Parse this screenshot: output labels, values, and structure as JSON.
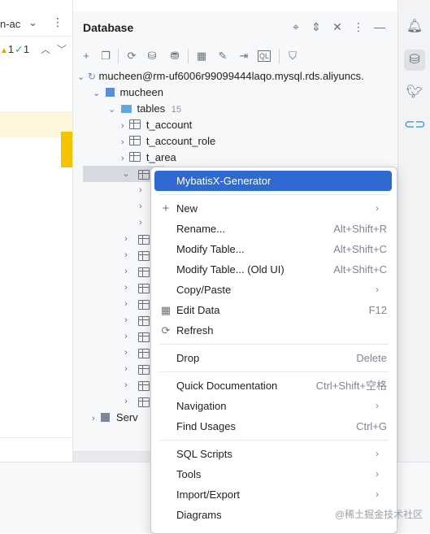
{
  "editor": {
    "tab_label": "n-ac",
    "warning_count": "1",
    "ok_count": "1"
  },
  "database": {
    "title": "Database",
    "connection": "mucheen@rm-uf6006r99099444laqo.mysql.rds.aliyuncs.",
    "schema": "mucheen",
    "tables_label": "tables",
    "tables_count": "15",
    "tables": [
      "t_account",
      "t_account_role",
      "t_area"
    ],
    "server_label": "Serv"
  },
  "menu": {
    "items": [
      {
        "label": "MybatisX-Generator",
        "shortcut": "",
        "submenu": false
      },
      {
        "label": "New",
        "shortcut": "",
        "submenu": true
      },
      {
        "label": "Rename...",
        "shortcut": "Alt+Shift+R",
        "submenu": false
      },
      {
        "label": "Modify Table...",
        "shortcut": "Alt+Shift+C",
        "submenu": false
      },
      {
        "label": "Modify Table... (Old UI)",
        "shortcut": "Alt+Shift+C",
        "submenu": false
      },
      {
        "label": "Copy/Paste",
        "shortcut": "",
        "submenu": true
      },
      {
        "label": "Edit Data",
        "shortcut": "F12",
        "submenu": false
      },
      {
        "label": "Refresh",
        "shortcut": "",
        "submenu": false
      },
      {
        "label": "Drop",
        "shortcut": "Delete",
        "submenu": false
      },
      {
        "label": "Quick Documentation",
        "shortcut": "Ctrl+Shift+空格",
        "submenu": false
      },
      {
        "label": "Navigation",
        "shortcut": "",
        "submenu": true
      },
      {
        "label": "Find Usages",
        "shortcut": "Ctrl+G",
        "submenu": false
      },
      {
        "label": "SQL Scripts",
        "shortcut": "",
        "submenu": true
      },
      {
        "label": "Tools",
        "shortcut": "",
        "submenu": true
      },
      {
        "label": "Import/Export",
        "shortcut": "",
        "submenu": true
      },
      {
        "label": "Diagrams",
        "shortcut": "",
        "submenu": false
      }
    ]
  },
  "watermark": "@稀土掘金技术社区",
  "colors": {
    "accent": "#2f6ad2",
    "selection": "#d5d9e0",
    "marker": "#f3c400"
  }
}
